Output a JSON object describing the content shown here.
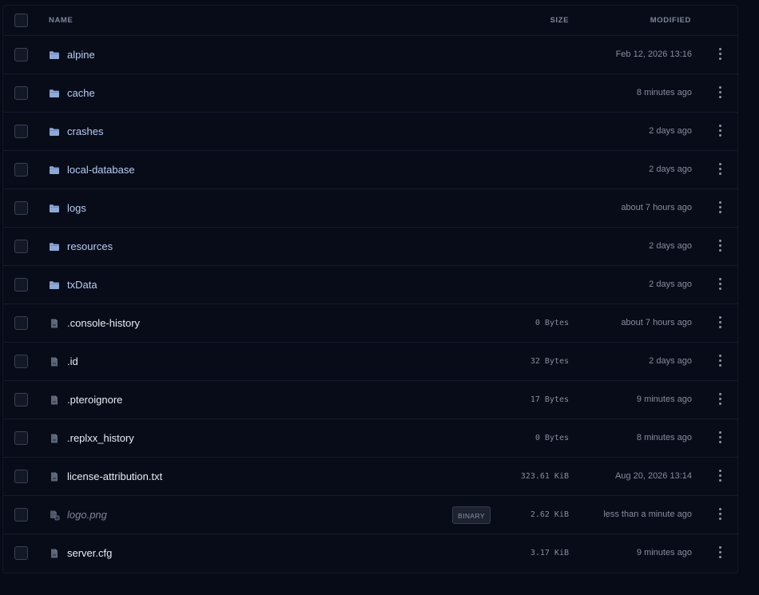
{
  "header": {
    "name_label": "NAME",
    "size_label": "SIZE",
    "modified_label": "MODIFIED"
  },
  "colors": {
    "background": "#070b17",
    "folder_icon": "#8fa8d6",
    "file_icon": "#5d6677",
    "folder_text": "#b8ccf2",
    "file_text": "#e8ecf4",
    "muted_text": "#858d9c"
  },
  "files": [
    {
      "name": "alpine",
      "type": "folder",
      "size": "",
      "modified": "Feb 12, 2026 13:16",
      "icon": "folder-icon"
    },
    {
      "name": "cache",
      "type": "folder",
      "size": "",
      "modified": "8 minutes ago",
      "icon": "folder-icon"
    },
    {
      "name": "crashes",
      "type": "folder",
      "size": "",
      "modified": "2 days ago",
      "icon": "folder-icon"
    },
    {
      "name": "local-database",
      "type": "folder",
      "size": "",
      "modified": "2 days ago",
      "icon": "folder-icon"
    },
    {
      "name": "logs",
      "type": "folder",
      "size": "",
      "modified": "about 7 hours ago",
      "icon": "folder-icon"
    },
    {
      "name": "resources",
      "type": "folder",
      "size": "",
      "modified": "2 days ago",
      "icon": "folder-icon"
    },
    {
      "name": "txData",
      "type": "folder",
      "size": "",
      "modified": "2 days ago",
      "icon": "folder-icon"
    },
    {
      "name": ".console-history",
      "type": "file",
      "size": "0 Bytes",
      "modified": "about 7 hours ago",
      "icon": "file-icon"
    },
    {
      "name": ".id",
      "type": "file",
      "size": "32 Bytes",
      "modified": "2 days ago",
      "icon": "file-icon"
    },
    {
      "name": ".pteroignore",
      "type": "file",
      "size": "17 Bytes",
      "modified": "9 minutes ago",
      "icon": "file-icon"
    },
    {
      "name": ".replxx_history",
      "type": "file",
      "size": "0 Bytes",
      "modified": "8 minutes ago",
      "icon": "file-icon"
    },
    {
      "name": "license-attribution.txt",
      "type": "file",
      "size": "323.61 KiB",
      "modified": "Aug 20, 2026 13:14",
      "icon": "file-icon"
    },
    {
      "name": "logo.png",
      "type": "binary",
      "badge": "BINARY",
      "size": "2.62 KiB",
      "modified": "less than a minute ago",
      "icon": "binary-file-icon"
    },
    {
      "name": "server.cfg",
      "type": "file",
      "size": "3.17 KiB",
      "modified": "9 minutes ago",
      "icon": "file-icon"
    }
  ]
}
